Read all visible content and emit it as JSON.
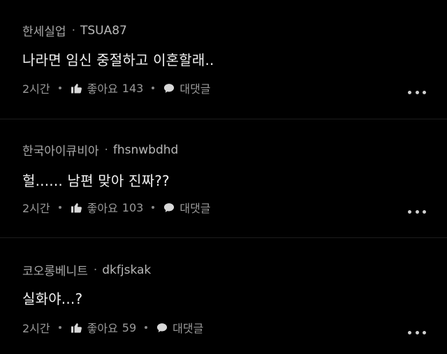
{
  "comments": [
    {
      "company": "한세실업",
      "separator": "·",
      "nickname": "TSUA87",
      "text": "나라면 임신 중절하고 이혼할래..",
      "time": "2시간",
      "like_label": "좋아요",
      "like_count": "143",
      "reply_label": "대댓글"
    },
    {
      "company": "한국아이큐비아",
      "separator": "·",
      "nickname": "fhsnwbdhd",
      "text": "헐...... 남편 맞아 진짜??",
      "time": "2시간",
      "like_label": "좋아요",
      "like_count": "103",
      "reply_label": "대댓글"
    },
    {
      "company": "코오롱베니트",
      "separator": "·",
      "nickname": "dkfjskak",
      "text": "실화야...?",
      "time": "2시간",
      "like_label": "좋아요",
      "like_count": "59",
      "reply_label": "대댓글"
    }
  ],
  "icons": {
    "like": "thumbs-up-icon",
    "reply": "speech-bubble-icon",
    "more": "more-horizontal-icon"
  },
  "colors": {
    "background": "#000000",
    "text": "#f2f2f2",
    "muted": "#9a9a9a"
  }
}
